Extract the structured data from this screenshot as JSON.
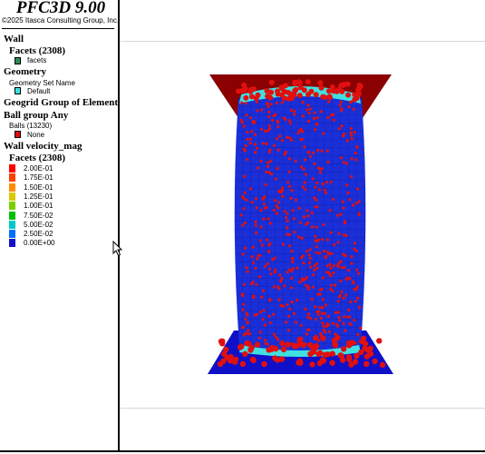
{
  "app": {
    "title": "PFC3D 9.00",
    "copyright": "©2025 Itasca Consulting Group, Inc."
  },
  "legend": {
    "wall": {
      "heading": "Wall",
      "facets_heading": "Facets (2308)",
      "facets_label": "facets",
      "facets_color": "#2e8b57"
    },
    "geometry": {
      "heading": "Geometry",
      "set_name_label": "Geometry Set Name",
      "default_label": "Default",
      "default_color": "#40e0e0"
    },
    "geogrid": {
      "heading": "Geogrid Group of Element"
    },
    "ball_group": {
      "heading": "Ball group Any",
      "balls_label": "Balls (13230)",
      "none_label": "None",
      "none_color": "#e01010"
    },
    "velocity": {
      "heading": "Wall velocity_mag",
      "facets_heading": "Facets (2308)",
      "scale": [
        {
          "label": "2.00E-01",
          "color": "#ff0000"
        },
        {
          "label": "1.75E-01",
          "color": "#ff4000"
        },
        {
          "label": "1.50E-01",
          "color": "#ff8c00"
        },
        {
          "label": "1.25E-01",
          "color": "#d8c800"
        },
        {
          "label": "1.00E-01",
          "color": "#7ccd00"
        },
        {
          "label": "7.50E-02",
          "color": "#00c000"
        },
        {
          "label": "5.00E-02",
          "color": "#00c8c8"
        },
        {
          "label": "2.50E-02",
          "color": "#0070ff"
        },
        {
          "label": "0.00E+00",
          "color": "#1010c8"
        }
      ]
    }
  },
  "colors": {
    "specimen": "#1a2fd8",
    "platen_top": "#8b0000",
    "platen_bottom": "#1010c8",
    "ball": "#e01010",
    "ring": "#40e0e0"
  }
}
